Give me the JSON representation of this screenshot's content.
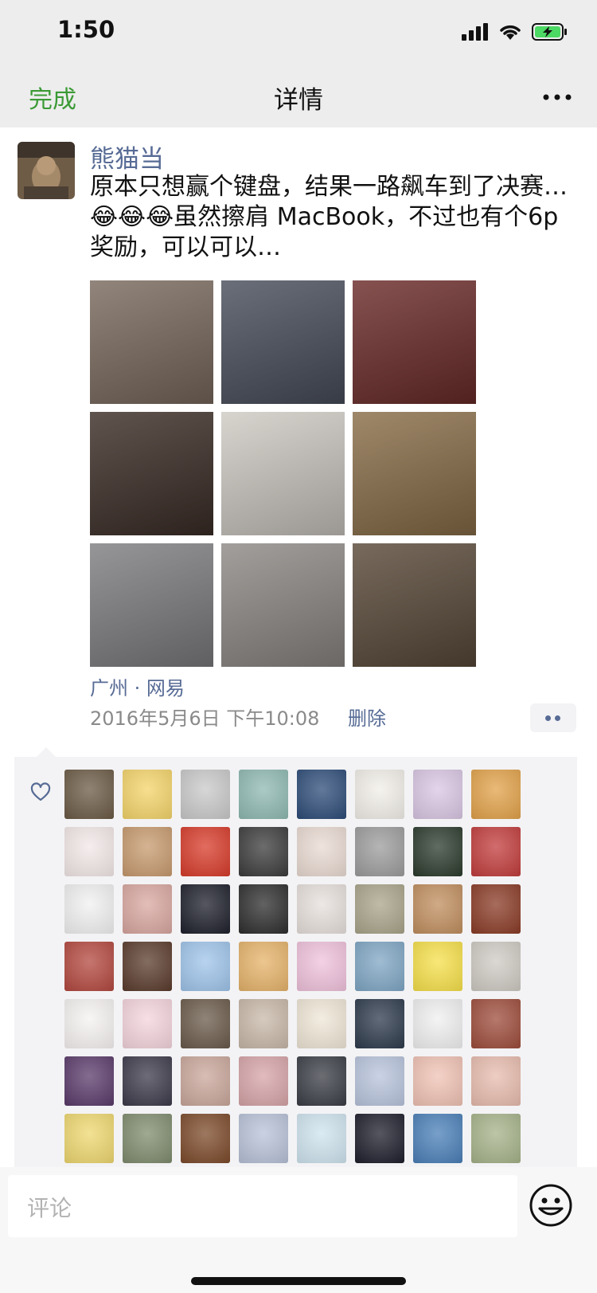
{
  "status": {
    "time": "1:50"
  },
  "nav": {
    "done_label": "完成",
    "title": "详情"
  },
  "post": {
    "author": "熊猫当",
    "text": "原本只想赢个键盘，结果一路飙车到了决赛…😂😂😂虽然擦肩 MacBook，不过也有个6p奖励，可以可以…",
    "photos": [
      {
        "icon": "poster-photo",
        "bg": "#7a6a5e"
      },
      {
        "icon": "stage-photo",
        "bg": "#4a4f5c"
      },
      {
        "icon": "auditorium-photo",
        "bg": "#6b2c2a"
      },
      {
        "icon": "hall-photo",
        "bg": "#3c2e27"
      },
      {
        "icon": "sand-writing-photo",
        "bg": "#cfcbc4"
      },
      {
        "icon": "snacks-photo",
        "bg": "#8a6e49"
      },
      {
        "icon": "medal-photo",
        "bg": "#7f7f82"
      },
      {
        "icon": "medal-photo",
        "bg": "#8e8a86"
      },
      {
        "icon": "plush-toy-photo",
        "bg": "#5a4a3a"
      }
    ],
    "location": "广州 · 网易",
    "timestamp": "2016年5月6日 下午10:08",
    "delete_label": "删除"
  },
  "likes": {
    "avatars": [
      "#6b5a45",
      "#f4d46a",
      "#c9c9c9",
      "#8fb9b2",
      "#2d4c78",
      "#f2efe9",
      "#d9c6e3",
      "#e2a24a",
      "#f3e8e8",
      "#c79a6e",
      "#d73b2a",
      "#3b3b3b",
      "#e9dad2",
      "#9c9c9c",
      "#2b3a2c",
      "#c23c3c",
      "#f1f1f1",
      "#d9a7a0",
      "#1d1f2b",
      "#2d2d2d",
      "#e7e0dc",
      "#a9a48a",
      "#c08e5e",
      "#8a3b26",
      "#b3483f",
      "#5a3b2c",
      "#9fc4ea",
      "#e6b36a",
      "#f0c2dc",
      "#7fa6c4",
      "#f6e04a",
      "#cfcac3",
      "#f6f2f2",
      "#f4d4dc",
      "#6a5a4a",
      "#c8b8a8",
      "#efe6d6",
      "#2d3a4c",
      "#f0f0f0",
      "#9d4c3b",
      "#5a3a6a",
      "#3c3a4a",
      "#caa79b",
      "#d6a4a8",
      "#3a3d45",
      "#b8c4dc",
      "#f0c2b4",
      "#e8bcae",
      "#efd870",
      "#7f8c6e",
      "#7c4a2a",
      "#b8c2d8",
      "#cfe4ef",
      "#1e1e2c",
      "#4a7fb8",
      "#a6b38a"
    ]
  },
  "composer": {
    "placeholder": "评论"
  },
  "colors": {
    "link": "#576b95",
    "accent_green": "#3b9a35",
    "nav_bg": "#ededed"
  }
}
